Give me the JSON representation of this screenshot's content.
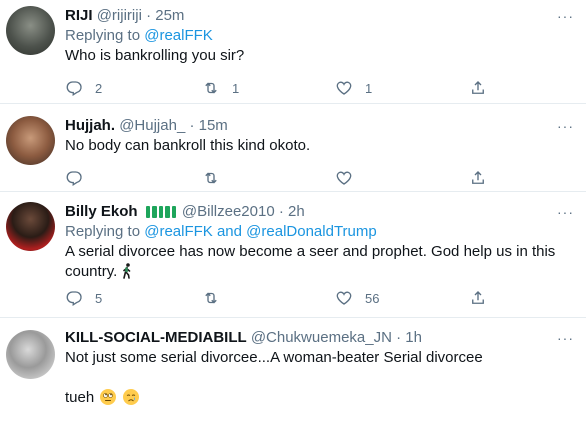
{
  "tweets": [
    {
      "name": "RIJI",
      "handle": "@rijiriji",
      "dot": "·",
      "time": "25m",
      "reply_prefix": "Replying to",
      "reply_to": "@realFFK",
      "reply_and": "",
      "reply_to2": "",
      "text": "Who is bankrolling you sir?",
      "counts": {
        "replies": "2",
        "retweets": "1",
        "likes": "1"
      }
    },
    {
      "name": "Hujjah.",
      "handle": "@Hujjah_",
      "dot": "·",
      "time": "15m",
      "text": "No body can bankroll this kind okoto.",
      "counts": {
        "replies": "",
        "retweets": "",
        "likes": ""
      }
    },
    {
      "name": "Billy Ekoh",
      "handle": "@Billzee2010",
      "dot": "·",
      "time": "2h",
      "reply_prefix": "Replying to",
      "reply_to": "@realFFK",
      "reply_and": "and",
      "reply_to2": "@realDonaldTrump",
      "text": "A serial divorcee has now become a seer and prophet.  God help us in this country.",
      "counts": {
        "replies": "5",
        "retweets": "",
        "likes": "56"
      }
    },
    {
      "name": "KILL-SOCIAL-MEDIABILL",
      "handle": "@Chukwuemeka_JN",
      "dot": "·",
      "time": "1h",
      "text": "Not just some serial divorcee...A woman-beater Serial divorcee",
      "text2": "tueh",
      "counts": {
        "replies": "",
        "retweets": "",
        "likes": ""
      }
    }
  ],
  "more_icon": "···",
  "colors": {
    "link": "#1b95e0",
    "muted": "#5b7083",
    "divider": "#e6ecf0",
    "flag_green": "#1ea55b"
  },
  "icons": [
    "reply-icon",
    "retweet-icon",
    "like-icon",
    "share-icon",
    "more-icon",
    "nigeria-flag-icon",
    "walking-person-icon",
    "rolling-eyes-emoji",
    "crying-face-emoji"
  ]
}
